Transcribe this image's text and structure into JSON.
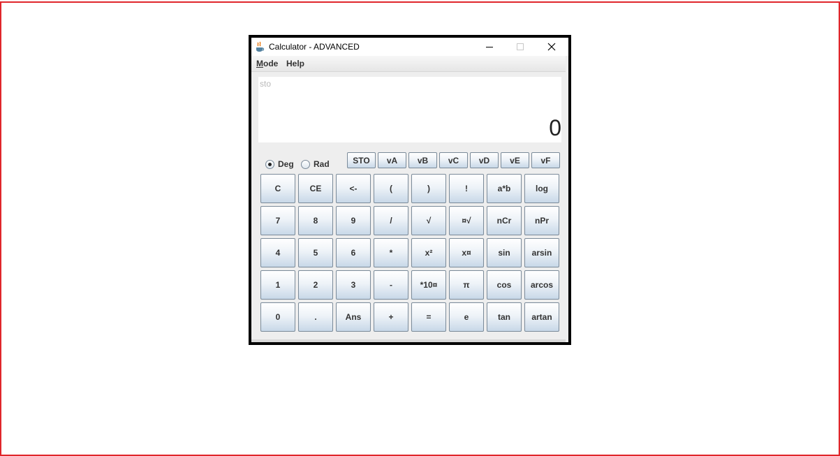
{
  "window": {
    "title": "Calculator - ADVANCED",
    "icon": "java-cup-icon",
    "controls": [
      "minimize-icon",
      "maximize-icon",
      "close-icon"
    ]
  },
  "menu": {
    "mode_mnemonic": "M",
    "mode_rest": "ode",
    "help": "Help"
  },
  "display": {
    "hint": "sto",
    "value": "0"
  },
  "angle_mode": {
    "deg": "Deg",
    "rad": "Rad",
    "selected": "Deg"
  },
  "memory_buttons": [
    "STO",
    "vA",
    "vB",
    "vC",
    "vD",
    "vE",
    "vF"
  ],
  "keypad": [
    [
      "C",
      "CE",
      "<-",
      "(",
      ")",
      "!",
      "a*b",
      "log"
    ],
    [
      "7",
      "8",
      "9",
      "/",
      "√",
      "¤√",
      "nCr",
      "nPr"
    ],
    [
      "4",
      "5",
      "6",
      "*",
      "x²",
      "x¤",
      "sin",
      "arsin"
    ],
    [
      "1",
      "2",
      "3",
      "-",
      "*10¤",
      "π",
      "cos",
      "arcos"
    ],
    [
      "0",
      ".",
      "Ans",
      "+",
      "=",
      "e",
      "tan",
      "artan"
    ]
  ],
  "colors": {
    "frame_border": "#e0262b",
    "window_border": "#000000",
    "button_gradient_bottom": "#c8d8e8"
  }
}
